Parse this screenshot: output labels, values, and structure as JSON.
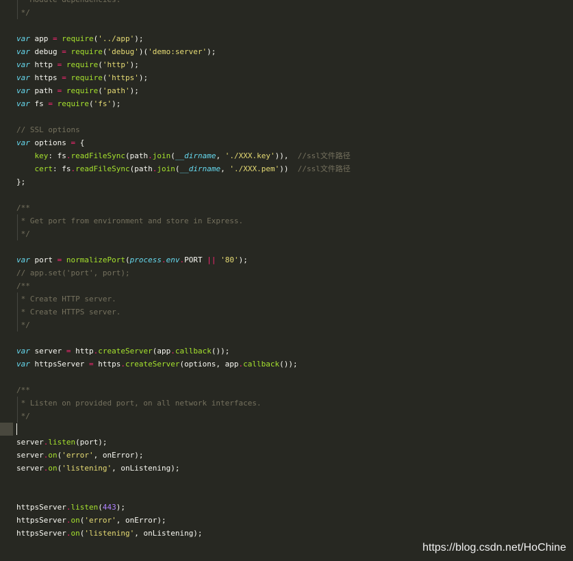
{
  "editor": {
    "lines": [
      {
        "text": " * Module dependencies.",
        "guide": true,
        "tokens": [
          {
            "t": " * Module dependencies.",
            "c": "c"
          }
        ]
      },
      {
        "text": " */",
        "guide": true,
        "tokens": [
          {
            "t": " */",
            "c": "c"
          }
        ]
      },
      {
        "text": "",
        "tokens": []
      },
      {
        "tokens": [
          {
            "t": "var",
            "c": "k"
          },
          {
            "t": " app "
          },
          {
            "t": "=",
            "c": "o"
          },
          {
            "t": " "
          },
          {
            "t": "require",
            "c": "f"
          },
          {
            "t": "("
          },
          {
            "t": "'../app'",
            "c": "s"
          },
          {
            "t": ");"
          }
        ]
      },
      {
        "tokens": [
          {
            "t": "var",
            "c": "k"
          },
          {
            "t": " debug "
          },
          {
            "t": "=",
            "c": "o"
          },
          {
            "t": " "
          },
          {
            "t": "require",
            "c": "f"
          },
          {
            "t": "("
          },
          {
            "t": "'debug'",
            "c": "s"
          },
          {
            "t": ")("
          },
          {
            "t": "'demo:server'",
            "c": "s"
          },
          {
            "t": ");"
          }
        ]
      },
      {
        "tokens": [
          {
            "t": "var",
            "c": "k"
          },
          {
            "t": " http "
          },
          {
            "t": "=",
            "c": "o"
          },
          {
            "t": " "
          },
          {
            "t": "require",
            "c": "f"
          },
          {
            "t": "("
          },
          {
            "t": "'http'",
            "c": "s"
          },
          {
            "t": ");"
          }
        ]
      },
      {
        "tokens": [
          {
            "t": "var",
            "c": "k"
          },
          {
            "t": " https "
          },
          {
            "t": "=",
            "c": "o"
          },
          {
            "t": " "
          },
          {
            "t": "require",
            "c": "f"
          },
          {
            "t": "("
          },
          {
            "t": "'https'",
            "c": "s"
          },
          {
            "t": ");"
          }
        ]
      },
      {
        "tokens": [
          {
            "t": "var",
            "c": "k"
          },
          {
            "t": " path "
          },
          {
            "t": "=",
            "c": "o"
          },
          {
            "t": " "
          },
          {
            "t": "require",
            "c": "f"
          },
          {
            "t": "("
          },
          {
            "t": "'path'",
            "c": "s"
          },
          {
            "t": ");"
          }
        ]
      },
      {
        "tokens": [
          {
            "t": "var",
            "c": "k"
          },
          {
            "t": " fs "
          },
          {
            "t": "=",
            "c": "o"
          },
          {
            "t": " "
          },
          {
            "t": "require",
            "c": "f"
          },
          {
            "t": "("
          },
          {
            "t": "'fs'",
            "c": "s"
          },
          {
            "t": ");"
          }
        ]
      },
      {
        "tokens": []
      },
      {
        "tokens": [
          {
            "t": "// SSL options",
            "c": "c"
          }
        ]
      },
      {
        "tokens": [
          {
            "t": "var",
            "c": "k"
          },
          {
            "t": " options "
          },
          {
            "t": "=",
            "c": "o"
          },
          {
            "t": " {"
          }
        ]
      },
      {
        "tokens": [
          {
            "t": "    "
          },
          {
            "t": "key",
            "c": "f"
          },
          {
            "t": ": fs"
          },
          {
            "t": ".",
            "c": "o"
          },
          {
            "t": "readFileSync",
            "c": "f"
          },
          {
            "t": "(path"
          },
          {
            "t": ".",
            "c": "o"
          },
          {
            "t": "join",
            "c": "f"
          },
          {
            "t": "("
          },
          {
            "t": "__dirname",
            "c": "p"
          },
          {
            "t": ", "
          },
          {
            "t": "'./XXX.key'",
            "c": "s"
          },
          {
            "t": ")),  "
          },
          {
            "t": "//ssl文件路径",
            "c": "c"
          }
        ]
      },
      {
        "tokens": [
          {
            "t": "    "
          },
          {
            "t": "cert",
            "c": "f"
          },
          {
            "t": ": fs"
          },
          {
            "t": ".",
            "c": "o"
          },
          {
            "t": "readFileSync",
            "c": "f"
          },
          {
            "t": "(path"
          },
          {
            "t": ".",
            "c": "o"
          },
          {
            "t": "join",
            "c": "f"
          },
          {
            "t": "("
          },
          {
            "t": "__dirname",
            "c": "p"
          },
          {
            "t": ", "
          },
          {
            "t": "'./XXX.pem'",
            "c": "s"
          },
          {
            "t": "))  "
          },
          {
            "t": "//ssl文件路径",
            "c": "c"
          }
        ]
      },
      {
        "tokens": [
          {
            "t": "};"
          }
        ]
      },
      {
        "tokens": []
      },
      {
        "tokens": [
          {
            "t": "/**",
            "c": "c"
          }
        ]
      },
      {
        "guide": true,
        "tokens": [
          {
            "t": " * Get port from environment and store in Express.",
            "c": "c"
          }
        ]
      },
      {
        "guide": true,
        "tokens": [
          {
            "t": " */",
            "c": "c"
          }
        ]
      },
      {
        "tokens": []
      },
      {
        "tokens": [
          {
            "t": "var",
            "c": "k"
          },
          {
            "t": " port "
          },
          {
            "t": "=",
            "c": "o"
          },
          {
            "t": " "
          },
          {
            "t": "normalizePort",
            "c": "f"
          },
          {
            "t": "("
          },
          {
            "t": "process",
            "c": "p"
          },
          {
            "t": ".",
            "c": "o"
          },
          {
            "t": "env",
            "c": "p"
          },
          {
            "t": ".",
            "c": "o"
          },
          {
            "t": "PORT "
          },
          {
            "t": "||",
            "c": "o"
          },
          {
            "t": " "
          },
          {
            "t": "'80'",
            "c": "s"
          },
          {
            "t": ");"
          }
        ]
      },
      {
        "tokens": [
          {
            "t": "// app.set('port', port);",
            "c": "c"
          }
        ]
      },
      {
        "tokens": [
          {
            "t": "/**",
            "c": "c"
          }
        ]
      },
      {
        "guide": true,
        "tokens": [
          {
            "t": " * Create HTTP server.",
            "c": "c"
          }
        ]
      },
      {
        "guide": true,
        "tokens": [
          {
            "t": " * Create HTTPS server.",
            "c": "c"
          }
        ]
      },
      {
        "guide": true,
        "tokens": [
          {
            "t": " */",
            "c": "c"
          }
        ]
      },
      {
        "tokens": []
      },
      {
        "tokens": [
          {
            "t": "var",
            "c": "k"
          },
          {
            "t": " server "
          },
          {
            "t": "=",
            "c": "o"
          },
          {
            "t": " http"
          },
          {
            "t": ".",
            "c": "o"
          },
          {
            "t": "createServer",
            "c": "f"
          },
          {
            "t": "(app"
          },
          {
            "t": ".",
            "c": "o"
          },
          {
            "t": "callback",
            "c": "f"
          },
          {
            "t": "());"
          }
        ]
      },
      {
        "tokens": [
          {
            "t": "var",
            "c": "k"
          },
          {
            "t": " httpsServer "
          },
          {
            "t": "=",
            "c": "o"
          },
          {
            "t": " https"
          },
          {
            "t": ".",
            "c": "o"
          },
          {
            "t": "createServer",
            "c": "f"
          },
          {
            "t": "(options, app"
          },
          {
            "t": ".",
            "c": "o"
          },
          {
            "t": "callback",
            "c": "f"
          },
          {
            "t": "());"
          }
        ]
      },
      {
        "tokens": []
      },
      {
        "tokens": [
          {
            "t": "/**",
            "c": "c"
          }
        ]
      },
      {
        "guide": true,
        "tokens": [
          {
            "t": " * Listen on provided port, on all network interfaces.",
            "c": "c"
          }
        ]
      },
      {
        "guide": true,
        "tokens": [
          {
            "t": " */",
            "c": "c"
          }
        ]
      },
      {
        "cursor": true,
        "tokens": []
      },
      {
        "tokens": [
          {
            "t": "server"
          },
          {
            "t": ".",
            "c": "o"
          },
          {
            "t": "listen",
            "c": "f"
          },
          {
            "t": "(port);"
          }
        ]
      },
      {
        "tokens": [
          {
            "t": "server"
          },
          {
            "t": ".",
            "c": "o"
          },
          {
            "t": "on",
            "c": "f"
          },
          {
            "t": "("
          },
          {
            "t": "'error'",
            "c": "s"
          },
          {
            "t": ", onError);"
          }
        ]
      },
      {
        "tokens": [
          {
            "t": "server"
          },
          {
            "t": ".",
            "c": "o"
          },
          {
            "t": "on",
            "c": "f"
          },
          {
            "t": "("
          },
          {
            "t": "'listening'",
            "c": "s"
          },
          {
            "t": ", onListening);"
          }
        ]
      },
      {
        "tokens": []
      },
      {
        "tokens": []
      },
      {
        "tokens": [
          {
            "t": "httpsServer"
          },
          {
            "t": ".",
            "c": "o"
          },
          {
            "t": "listen",
            "c": "f"
          },
          {
            "t": "("
          },
          {
            "t": "443",
            "c": "n"
          },
          {
            "t": ");"
          }
        ]
      },
      {
        "tokens": [
          {
            "t": "httpsServer"
          },
          {
            "t": ".",
            "c": "o"
          },
          {
            "t": "on",
            "c": "f"
          },
          {
            "t": "("
          },
          {
            "t": "'error'",
            "c": "s"
          },
          {
            "t": ", onError);"
          }
        ]
      },
      {
        "tokens": [
          {
            "t": "httpsServer"
          },
          {
            "t": ".",
            "c": "o"
          },
          {
            "t": "on",
            "c": "f"
          },
          {
            "t": "("
          },
          {
            "t": "'listening'",
            "c": "s"
          },
          {
            "t": ", onListening);"
          }
        ]
      }
    ]
  },
  "watermark": "https://blog.csdn.net/HoChine",
  "colors": {
    "background": "#272822",
    "keyword": "#66d9ef",
    "operator": "#f92672",
    "function": "#a6e22e",
    "string": "#e6db74",
    "comment": "#75715e",
    "number": "#ae81ff"
  }
}
